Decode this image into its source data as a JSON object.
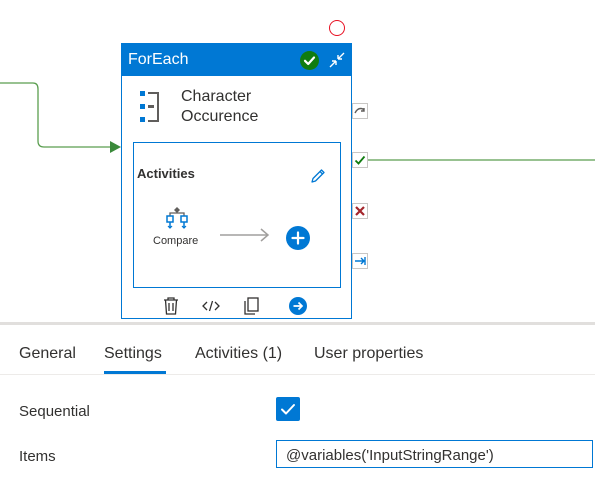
{
  "node": {
    "type_title": "ForEach",
    "activity_name_line1": "Character",
    "activity_name_line2": "Occurence",
    "status": "succeeded"
  },
  "inner": {
    "title": "Activities",
    "child_activity": "Compare"
  },
  "tabs": [
    {
      "label": "General",
      "active": false
    },
    {
      "label": "Settings",
      "active": true
    },
    {
      "label": "Activities (1)",
      "active": false
    },
    {
      "label": "User properties",
      "active": false
    }
  ],
  "settings": {
    "sequential_label": "Sequential",
    "sequential_checked": true,
    "items_label": "Items",
    "items_value": "@variables('InputStringRange')"
  },
  "colors": {
    "accent": "#0078d4",
    "success": "#107c10",
    "failure": "#a4262c",
    "connector": "#3a8a3a"
  }
}
